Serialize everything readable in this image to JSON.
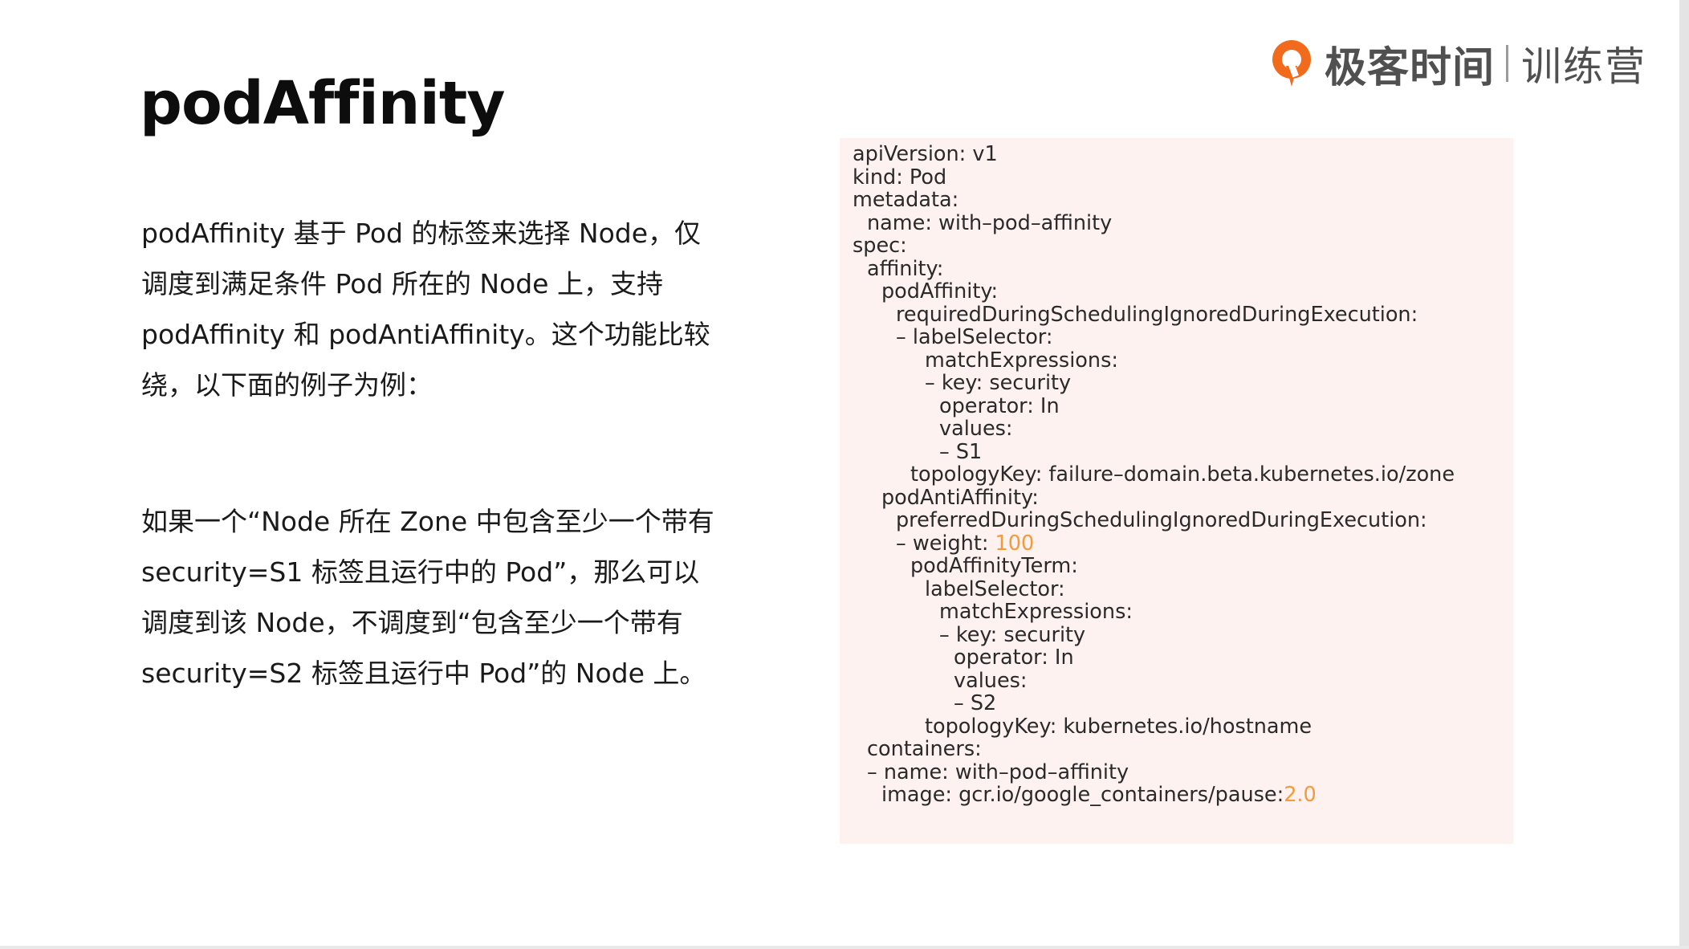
{
  "brand": {
    "logo_icon": "geektime-logo-icon",
    "name": "极客时间",
    "sub": "训练营",
    "accent_color": "#f26a1b"
  },
  "title": "podAffinity",
  "paragraphs": [
    "podAffinity 基于 Pod 的标签来选择 Node，仅调度到满足条件 Pod 所在的 Node  上，支持podAffinity 和 podAntiAffinity。这个功能比较绕，以下面的例子为例：",
    "如果一个“Node 所在 Zone 中包含至少一个带有 security=S1 标签且运行中的 Pod”，那么可以调度到该 Node，不调度到“包含至少一个带有 security=S2 标签且运行中 Pod”的 Node 上。"
  ],
  "code": {
    "background": "#fdf2ef",
    "number_color": "#f29a3c",
    "lines": [
      {
        "indent": 0,
        "text": "apiVersion: v1"
      },
      {
        "indent": 0,
        "text": "kind: Pod"
      },
      {
        "indent": 0,
        "text": "metadata:"
      },
      {
        "indent": 1,
        "text": "name: with–pod–affinity"
      },
      {
        "indent": 0,
        "text": "spec:"
      },
      {
        "indent": 1,
        "text": "affinity:"
      },
      {
        "indent": 2,
        "text": "podAffinity:"
      },
      {
        "indent": 3,
        "text": "requiredDuringSchedulingIgnoredDuringExecution:"
      },
      {
        "indent": 3,
        "text": "– labelSelector:"
      },
      {
        "indent": 5,
        "text": "matchExpressions:"
      },
      {
        "indent": 5,
        "text": "– key: security"
      },
      {
        "indent": 6,
        "text": "operator: In"
      },
      {
        "indent": 6,
        "text": "values:"
      },
      {
        "indent": 6,
        "text": "– S1"
      },
      {
        "indent": 4,
        "text": "topologyKey: failure–domain.beta.kubernetes.io/zone"
      },
      {
        "indent": 2,
        "text": "podAntiAffinity:"
      },
      {
        "indent": 3,
        "text": "preferredDuringSchedulingIgnoredDuringExecution:"
      },
      {
        "indent": 3,
        "text": "– weight: ",
        "num": "100"
      },
      {
        "indent": 4,
        "text": "podAffinityTerm:"
      },
      {
        "indent": 5,
        "text": "labelSelector:"
      },
      {
        "indent": 6,
        "text": "matchExpressions:"
      },
      {
        "indent": 6,
        "text": "– key: security"
      },
      {
        "indent": 7,
        "text": "operator: In"
      },
      {
        "indent": 7,
        "text": "values:"
      },
      {
        "indent": 7,
        "text": "– S2"
      },
      {
        "indent": 5,
        "text": "topologyKey: kubernetes.io/hostname"
      },
      {
        "indent": 1,
        "text": "containers:"
      },
      {
        "indent": 1,
        "text": "– name: with–pod–affinity"
      },
      {
        "indent": 2,
        "text": "image: gcr.io/google_containers/pause:",
        "num": "2.0"
      }
    ]
  }
}
